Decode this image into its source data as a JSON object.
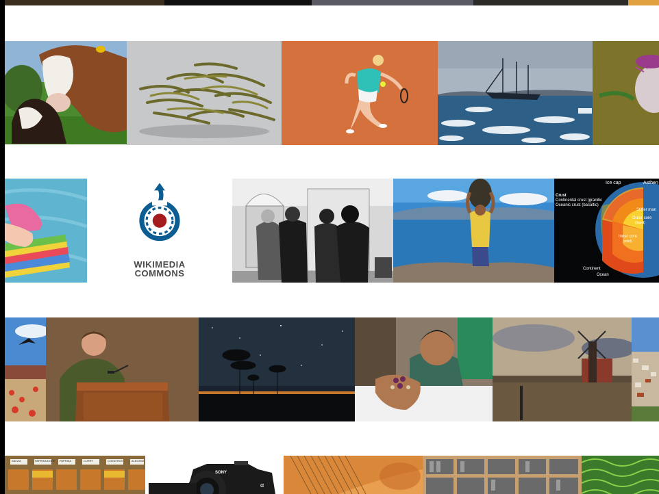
{
  "gallery": {
    "rows": [
      {
        "name": "row-1",
        "images": [
          {
            "name": "cow-and-calf-image",
            "subject": "cow nuzzling a calf on grass"
          },
          {
            "name": "green-tea-leaves-image",
            "subject": "dried green tea leaves"
          },
          {
            "name": "tennis-player-image",
            "subject": "tennis player on clay court"
          },
          {
            "name": "tall-ship-iceberg-image",
            "subject": "tall ship among icebergs"
          },
          {
            "name": "thistle-flower-image",
            "subject": "purple thistle flower"
          }
        ]
      },
      {
        "name": "row-2",
        "images": [
          {
            "name": "child-on-float-image",
            "subject": "child on rainbow pool float"
          },
          {
            "name": "wikimedia-commons-logo",
            "subject": "Wikimedia Commons logo"
          },
          {
            "name": "oval-office-meeting-image",
            "subject": "black and white meeting photo"
          },
          {
            "name": "man-carrying-oysters-image",
            "subject": "man carrying sack on shore"
          },
          {
            "name": "earth-structure-diagram",
            "subject": "earth interior cutaway"
          }
        ]
      },
      {
        "name": "row-3",
        "images": [
          {
            "name": "bird-over-field-image",
            "subject": "bird flying over crowd"
          },
          {
            "name": "speaker-at-podium-image",
            "subject": "man speaking at podium"
          },
          {
            "name": "night-sky-trees-image",
            "subject": "trees under starry sky"
          },
          {
            "name": "child-holding-beans-image",
            "subject": "child holding beans"
          },
          {
            "name": "windmill-canal-image",
            "subject": "windmill by canal"
          },
          {
            "name": "hillside-town-image",
            "subject": "hillside town"
          }
        ]
      },
      {
        "name": "row-4",
        "images": [
          {
            "name": "spice-market-image",
            "subject": "spice market bins"
          },
          {
            "name": "camera-image",
            "subject": "black camera"
          },
          {
            "name": "piano-strings-image",
            "subject": "piano interior"
          },
          {
            "name": "type-case-image",
            "subject": "printer type case"
          },
          {
            "name": "green-leaf-texture-image",
            "subject": "green cell texture"
          }
        ]
      }
    ]
  },
  "logo": {
    "line1": "WIKIMEDIA",
    "line2": "COMMONS",
    "colors": {
      "blue": "#0b5d92",
      "red": "#a51c1c",
      "text": "#4a4a4a"
    }
  },
  "earth_diagram": {
    "labels": {
      "ice_cap": "Ice cap",
      "astheno": "Asthen",
      "crust": "Crust",
      "continental": "Continental crust (granitic",
      "oceanic": "Oceanic crust (basaltic)",
      "stiffer_mantle": "Stiffer man",
      "outer_core": "Outer core",
      "outer_core_state": "(liquid)",
      "inner_core": "Inner core",
      "inner_core_state": "(solid)",
      "continent": "Continent",
      "ocean": "Ocean"
    }
  },
  "spice_labels": [
    "SALVIA",
    "PAPRIKA DOCE",
    "PAPRIKA",
    "CURRY",
    "COENTROS",
    "ALECRIM"
  ],
  "camera_labels": {
    "brand": "SONY",
    "model": "α"
  }
}
